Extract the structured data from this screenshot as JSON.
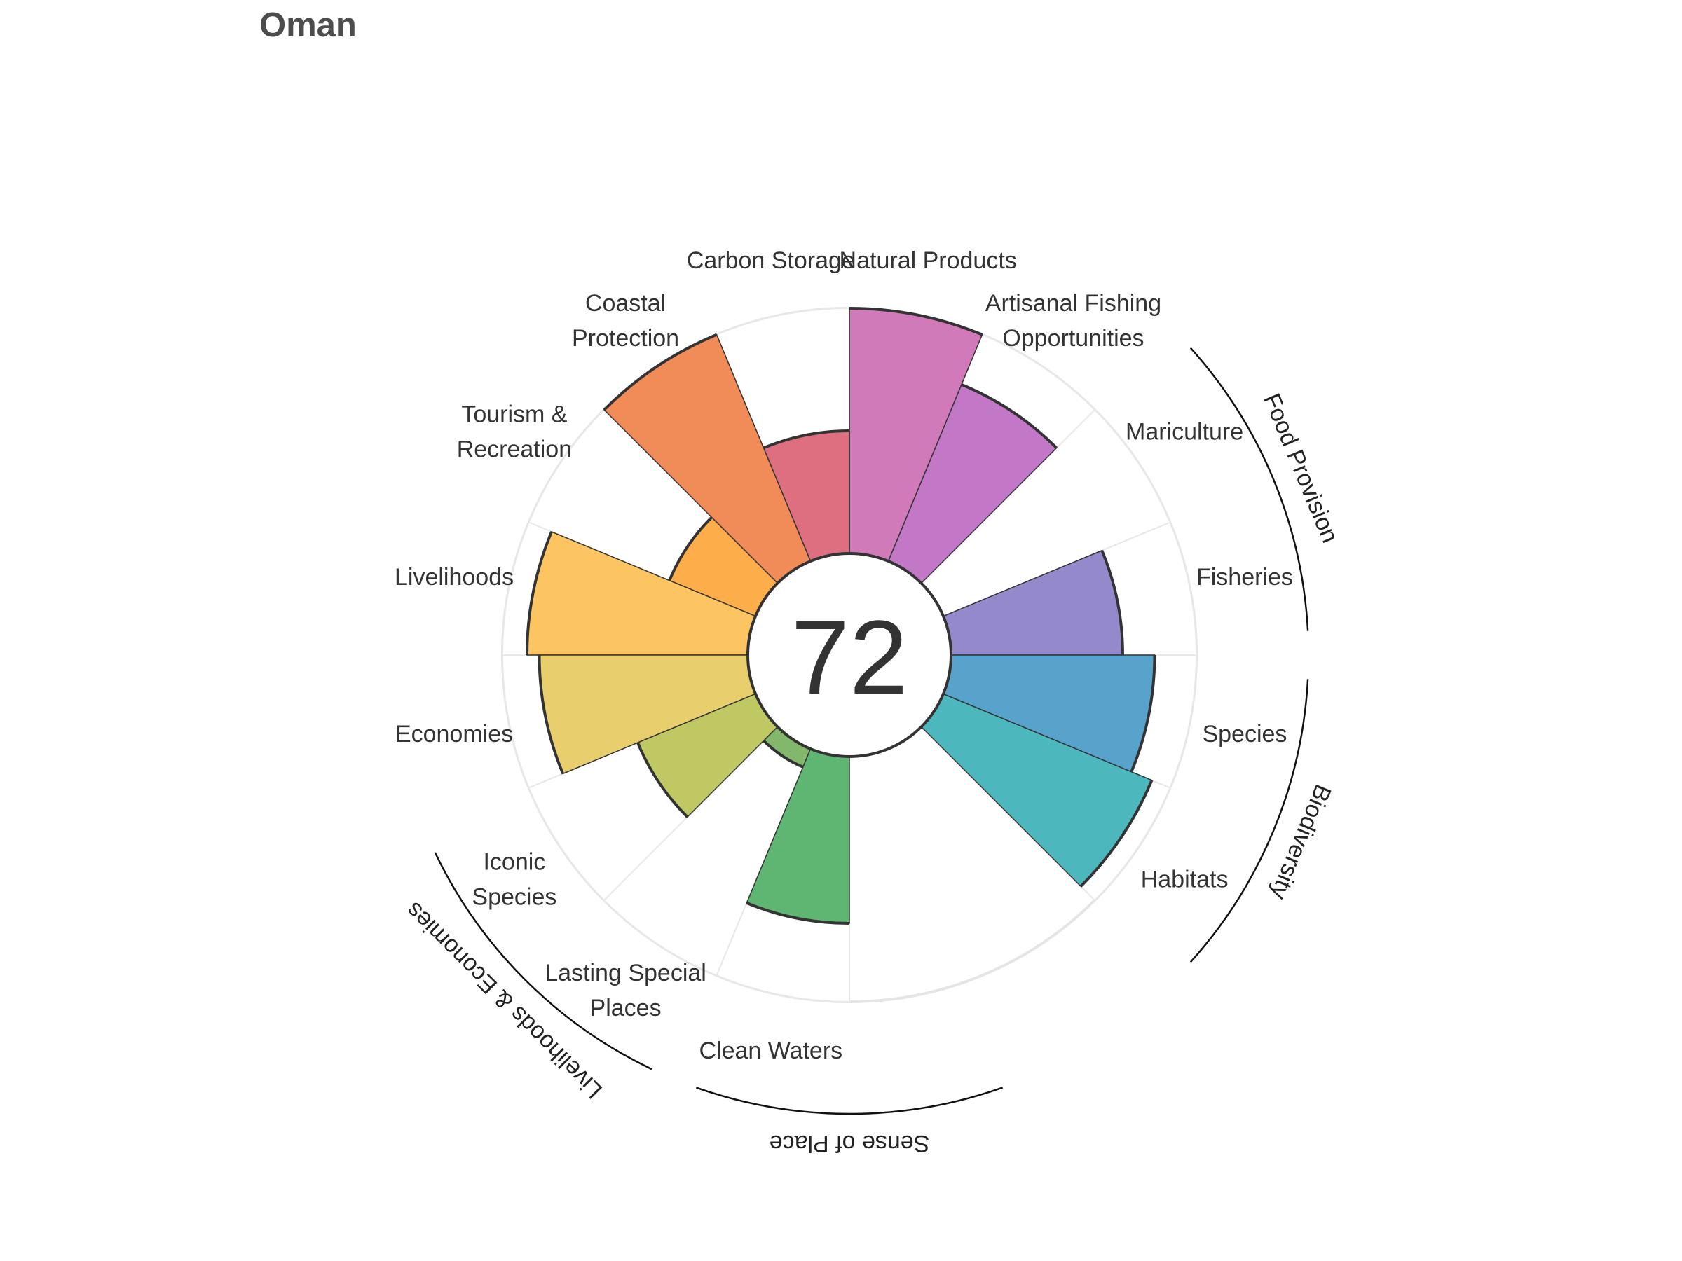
{
  "title": "Oman",
  "chart_data": {
    "type": "polar-bar",
    "title": "Oman",
    "center_score": "72",
    "value_range": [
      0,
      100
    ],
    "segments": [
      {
        "label": [
          "Fisheries"
        ],
        "value": 70,
        "color": "#9489cb"
      },
      {
        "label": [
          "Mariculture"
        ],
        "value": 0,
        "color": "#8a7fc8"
      },
      {
        "label": [
          "Artisanal Fishing",
          "Opportunities"
        ],
        "value": 78,
        "color": "#c278c6"
      },
      {
        "label": [
          "Natural Products"
        ],
        "value": 100,
        "color": "#d07ab9"
      },
      {
        "label": [
          "Carbon Storage"
        ],
        "value": 50,
        "color": "#dd6f80"
      },
      {
        "label": [
          "Coastal",
          "Protection"
        ],
        "value": 100,
        "color": "#f18b58"
      },
      {
        "label": [
          "Tourism &",
          "Recreation"
        ],
        "value": 38,
        "color": "#fdad4a"
      },
      {
        "label": [
          "Livelihoods"
        ],
        "value": 90,
        "color": "#fdc562"
      },
      {
        "label": [
          "Economies"
        ],
        "value": 85,
        "color": "#e9ce6e"
      },
      {
        "label": [
          "Iconic",
          "Species"
        ],
        "value": 52,
        "color": "#bfc862"
      },
      {
        "label": [
          "Lasting Special",
          "Places"
        ],
        "value": 8,
        "color": "#83b86c"
      },
      {
        "label": [
          "Clean Waters"
        ],
        "value": 68,
        "color": "#5fb673"
      },
      {
        "label": [
          "Habitats"
        ],
        "value": 92,
        "color": "#4cb8bd"
      },
      {
        "label": [
          "Species"
        ],
        "value": 83,
        "color": "#58a3cb"
      }
    ],
    "groups": [
      {
        "label": "Food Provision"
      },
      {
        "label": "Biodiversity"
      },
      {
        "label": "Sense of Place"
      },
      {
        "label": "Livelihoods & Economies"
      }
    ]
  }
}
